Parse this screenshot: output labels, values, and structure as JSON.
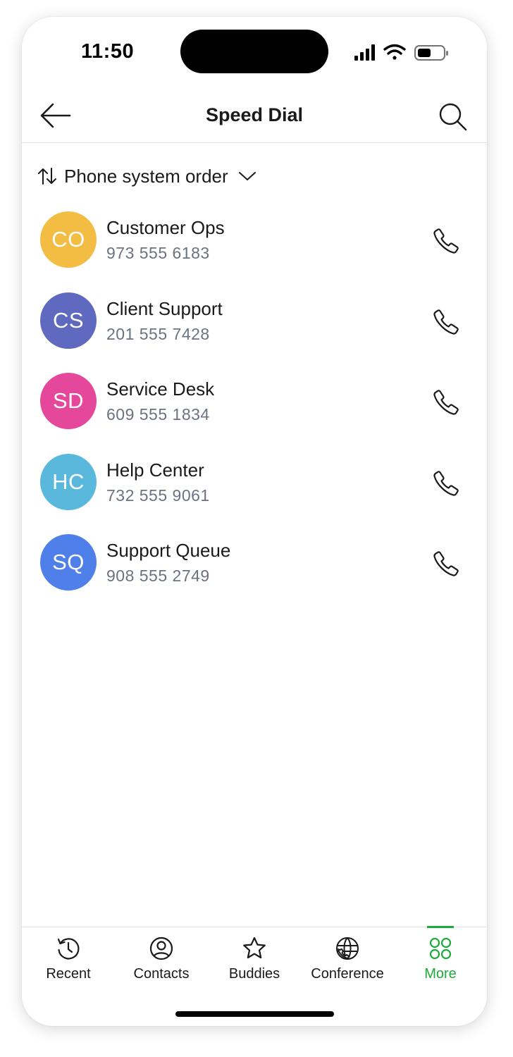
{
  "status_bar": {
    "time": "11:50"
  },
  "header": {
    "title": "Speed Dial"
  },
  "sort": {
    "label": "Phone system order"
  },
  "contacts": [
    {
      "initials": "CO",
      "name": "Customer Ops",
      "number": "973 555 6183",
      "color": "#f2bd42"
    },
    {
      "initials": "CS",
      "name": "Client Support",
      "number": "201 555 7428",
      "color": "#5f69bf"
    },
    {
      "initials": "SD",
      "name": "Service Desk",
      "number": "609 555 1834",
      "color": "#e5489a"
    },
    {
      "initials": "HC",
      "name": "Help Center",
      "number": "732 555 9061",
      "color": "#5ab8dc"
    },
    {
      "initials": "SQ",
      "name": "Support Queue",
      "number": "908 555 2749",
      "color": "#4f7fe8"
    }
  ],
  "tabs": [
    {
      "label": "Recent",
      "icon": "history-clock-icon"
    },
    {
      "label": "Contacts",
      "icon": "person-circle-icon"
    },
    {
      "label": "Buddies",
      "icon": "star-icon"
    },
    {
      "label": "Conference",
      "icon": "globe-phone-icon"
    },
    {
      "label": "More",
      "icon": "four-circles-icon",
      "active": true
    }
  ],
  "colors": {
    "accent": "#1faa3c",
    "secondary_text": "#6b7280"
  }
}
